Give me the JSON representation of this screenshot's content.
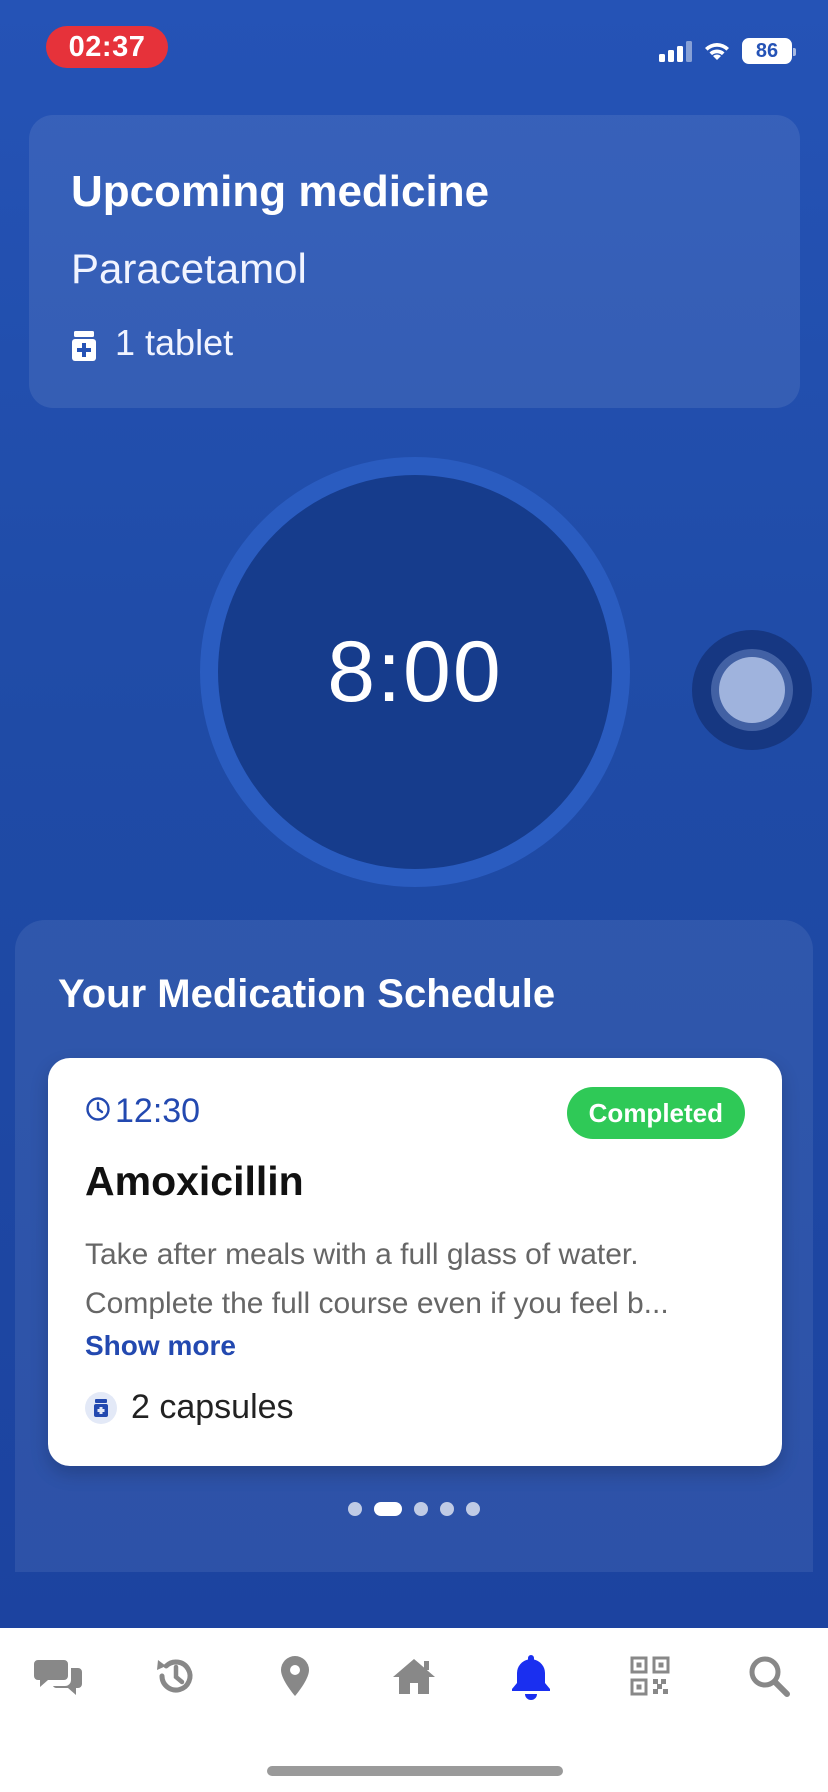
{
  "status_bar": {
    "time": "02:37",
    "battery": "86"
  },
  "upcoming": {
    "title": "Upcoming medicine",
    "medicine": "Paracetamol",
    "dose": "1 tablet"
  },
  "timer": {
    "value": "8:00"
  },
  "schedule": {
    "title": "Your Medication Schedule",
    "card": {
      "time": "12:30",
      "status": "Completed",
      "name": "Amoxicillin",
      "description": "Take after meals with a full glass of water. Complete the full course even if you feel b...",
      "show_more": "Show more",
      "dose": "2 capsules"
    },
    "pagination": {
      "total": 5,
      "active_index": 1
    }
  },
  "nav": {
    "items": [
      {
        "icon": "chat-icon"
      },
      {
        "icon": "history-icon"
      },
      {
        "icon": "location-icon"
      },
      {
        "icon": "home-icon"
      },
      {
        "icon": "bell-icon",
        "active": true
      },
      {
        "icon": "qr-code-icon"
      },
      {
        "icon": "search-icon"
      }
    ]
  },
  "colors": {
    "background": "#2553b6",
    "accent": "#2349b0",
    "completed": "#2fc957",
    "record": "#e6323a",
    "active_nav": "#1a2ff0",
    "inactive_nav": "#888888"
  }
}
